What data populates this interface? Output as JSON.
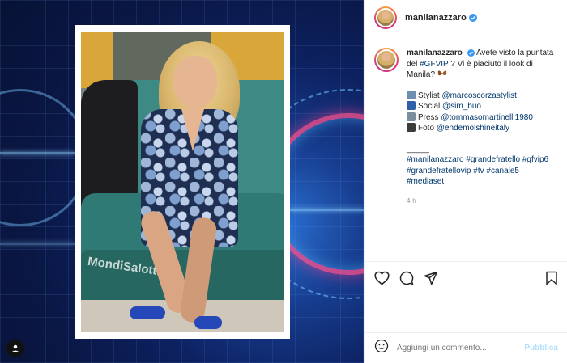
{
  "post": {
    "photo_caption_overlay": "MondiSalotti"
  },
  "header": {
    "username": "manilanazzaro"
  },
  "caption": {
    "username": "manilanazzaro",
    "line1_text": "Avete visto la puntata del ",
    "line1_tag": "#GFVIP",
    "line1_rest": " ? Vi è piaciuto il look di Manila? ",
    "credits": [
      {
        "label": "Stylist ",
        "handle": "@marcoscorzastylist",
        "icon_color": "#6d8fb0"
      },
      {
        "label": "Social ",
        "handle": "@sim_buo",
        "icon_color": "#2f5fa8"
      },
      {
        "label": "Press ",
        "handle": "@tommasomartinelli1980",
        "icon_color": "#7b8ea0"
      },
      {
        "label": "Foto ",
        "handle": "@endemolshineitaly",
        "icon_color": "#3b3b3b"
      }
    ],
    "divider": "_____",
    "hashtags": "#manilanazzaro #grandefratello #gfvip6 #grandefratellovip #tv #canale5 #mediaset",
    "time": "4 h"
  },
  "actions": {
    "like_icon": "heart-icon",
    "comment_icon": "comment-icon",
    "share_icon": "send-icon",
    "save_icon": "bookmark-icon"
  },
  "comment": {
    "placeholder": "Aggiungi un commento...",
    "publish_label": "Pubblica"
  },
  "colors": {
    "link": "#00376b",
    "verified": "#3897f0",
    "publish_disabled": "#b2dffc"
  }
}
